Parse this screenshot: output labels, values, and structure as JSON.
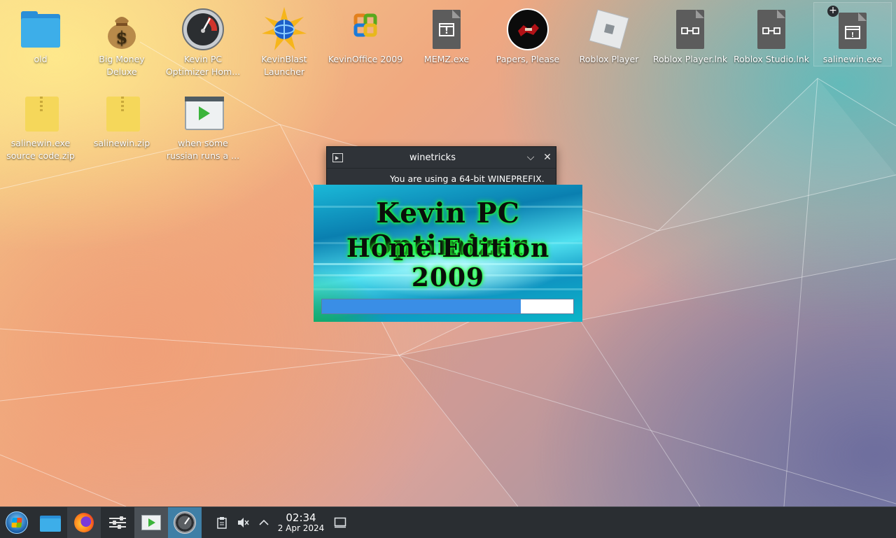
{
  "desktop": {
    "icons": [
      {
        "label": "old",
        "icon": "folder-icon"
      },
      {
        "label": "Big Money Deluxe",
        "icon": "money-bag-icon"
      },
      {
        "label": "Kevin PC Optimizer Hom...",
        "icon": "gauge-icon"
      },
      {
        "label": "KevinBlast Launcher",
        "icon": "globe-burst-icon"
      },
      {
        "label": "KevinOffice 2009",
        "icon": "office-logo-icon"
      },
      {
        "label": "MEMZ.exe",
        "icon": "exe-file-icon"
      },
      {
        "label": "Papers, Please",
        "icon": "papers-please-icon"
      },
      {
        "label": "Roblox Player",
        "icon": "roblox-icon"
      },
      {
        "label": "Roblox Player.lnk",
        "icon": "link-file-icon"
      },
      {
        "label": "Roblox Studio.lnk",
        "icon": "link-file-icon"
      },
      {
        "label": "salinewin.exe",
        "icon": "exe-file-icon"
      },
      {
        "label": "salinewin.exe source code.zip",
        "icon": "zip-icon"
      },
      {
        "label": "salinewin.zip",
        "icon": "zip-icon"
      },
      {
        "label": "when some russian runs a ...",
        "icon": "video-file-icon"
      }
    ],
    "exe_mark": "!",
    "link_mark": "⊡→⊡"
  },
  "winetricks": {
    "title": "winetricks",
    "message": "You are using a 64-bit WINEPREFIX."
  },
  "splash": {
    "title_line1": "Kevin PC Optimizer",
    "title_line2": "Home Edition 2009",
    "progress_fraction": 0.79
  },
  "taskbar": {
    "clock_time": "02:34",
    "clock_date": "2 Apr 2024"
  },
  "colors": {
    "accent": "#3daee9",
    "progress": "#3a8ee6",
    "taskbar": "#2a2e32"
  }
}
